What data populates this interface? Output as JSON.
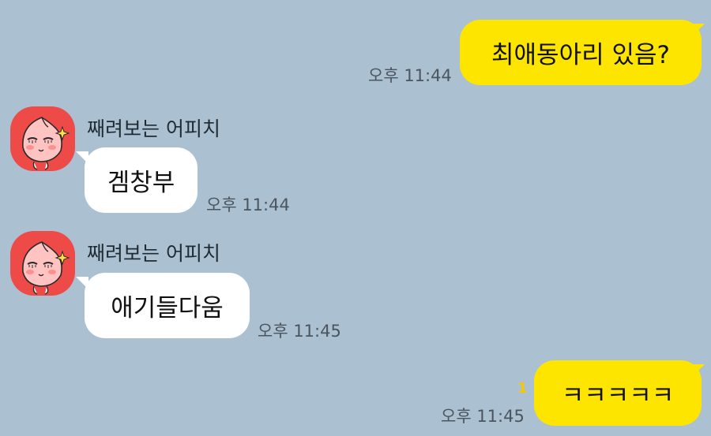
{
  "colors": {
    "background": "#abc1d1",
    "my_bubble": "#fee500",
    "their_bubble": "#ffffff",
    "avatar_bg": "#ee4a47",
    "unread_count": "#f6c800"
  },
  "messages": [
    {
      "from": "me",
      "text": "최애동아리 있음?",
      "time": "오후 11:44"
    },
    {
      "from": "them",
      "sender": "째려보는 어피치",
      "avatar_icon": "apeach-glare-icon",
      "text": "겜창부",
      "time": "오후 11:44"
    },
    {
      "from": "them",
      "sender": "째려보는 어피치",
      "avatar_icon": "apeach-glare-icon",
      "text": "애기들다움",
      "time": "오후 11:45"
    },
    {
      "from": "me",
      "text": "ㅋㅋㅋㅋㅋ",
      "time": "오후 11:45",
      "unread": "1"
    }
  ]
}
